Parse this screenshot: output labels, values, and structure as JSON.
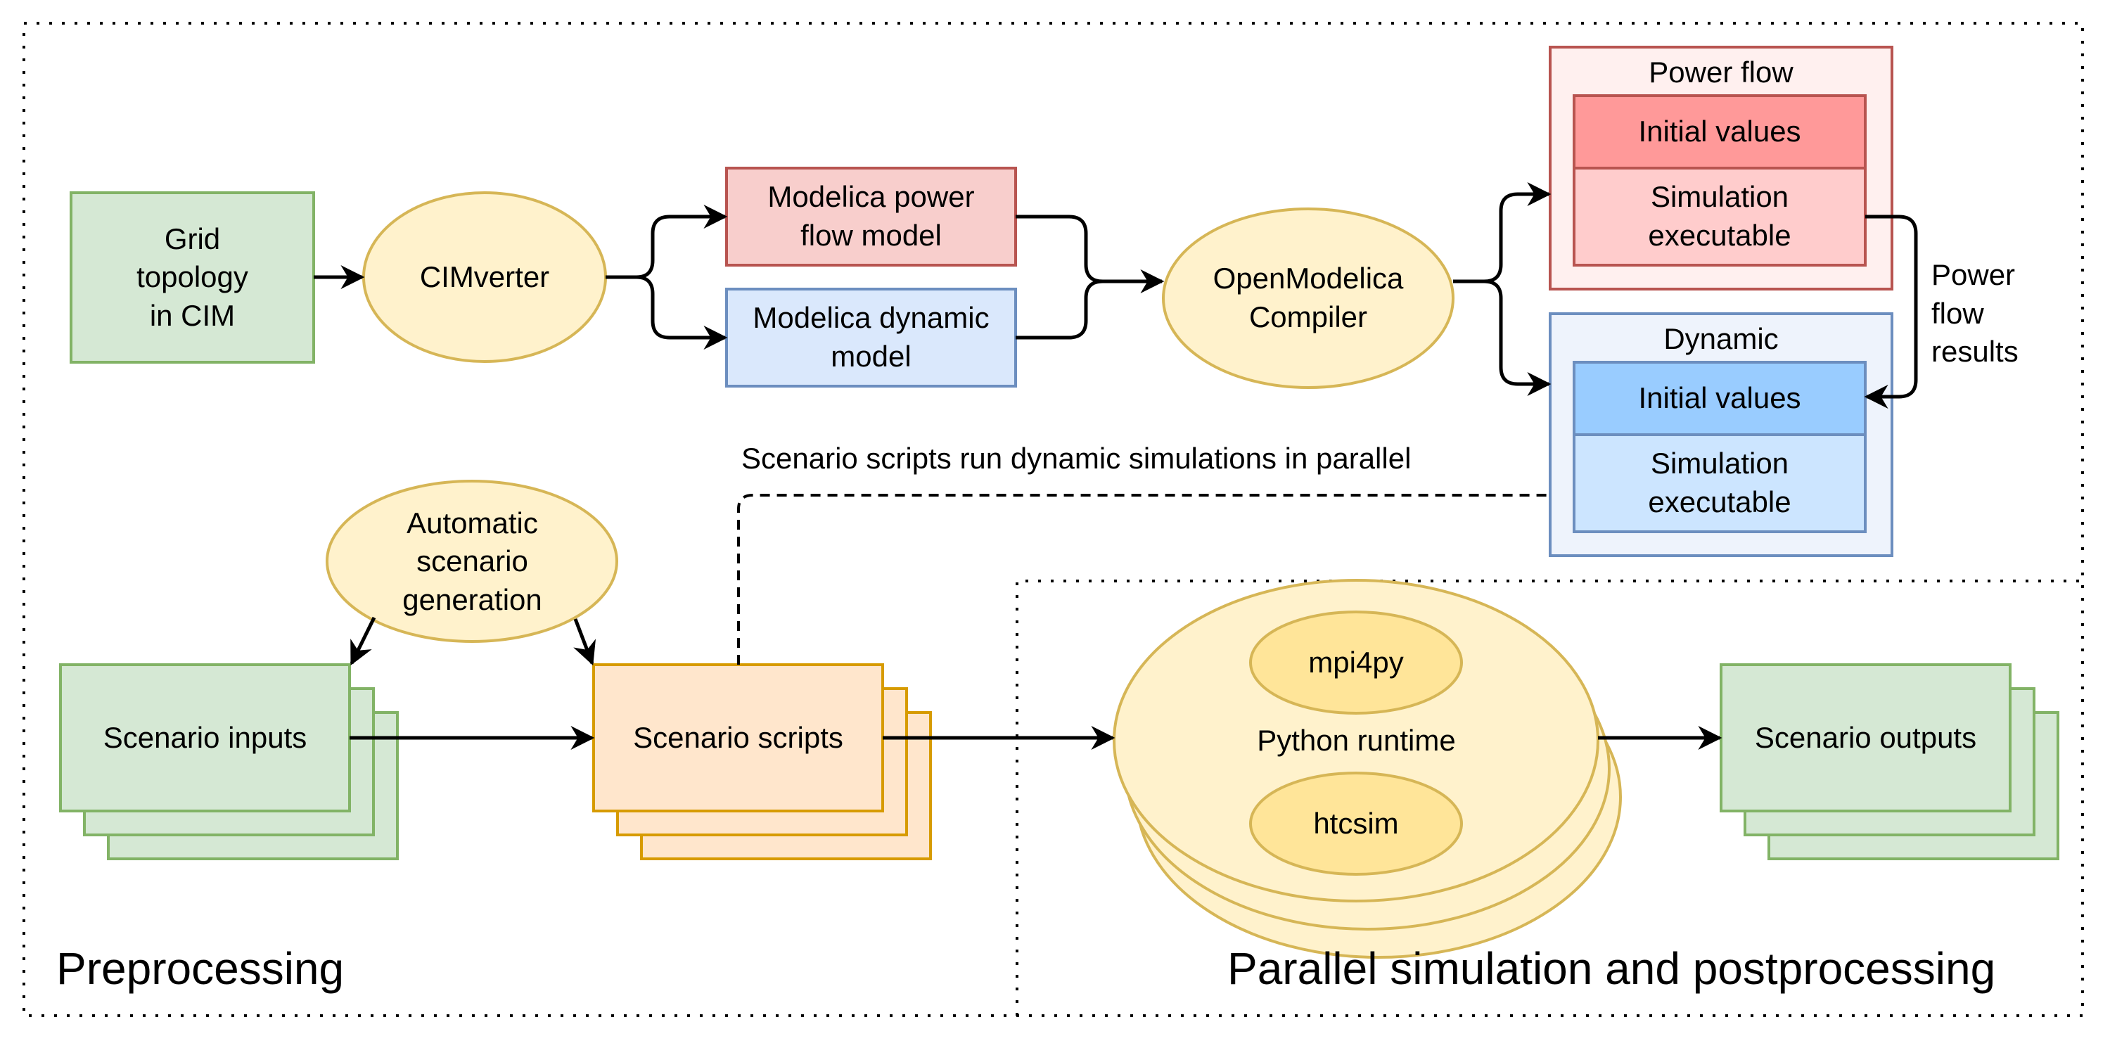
{
  "diagram": {
    "sections": {
      "preprocessing": "Preprocessing",
      "parallel": "Parallel simulation and postprocessing"
    },
    "nodes": {
      "grid_topology": "Grid\ntopology\nin CIM",
      "cimverter": "CIMverter",
      "modelica_power_flow": "Modelica power\nflow model",
      "modelica_dynamic": "Modelica dynamic\nmodel",
      "openmodelica": "OpenModelica\nCompiler",
      "power_flow_group": {
        "title": "Power flow",
        "initial_values": "Initial values",
        "simulation_executable": "Simulation\nexecutable"
      },
      "dynamic_group": {
        "title": "Dynamic",
        "initial_values": "Initial values",
        "simulation_executable": "Simulation\nexecutable"
      },
      "automatic_scenario": "Automatic\nscenario\ngeneration",
      "scenario_inputs": "Scenario inputs",
      "scenario_scripts": "Scenario scripts",
      "python_runtime": "Python  runtime",
      "mpi4py": "mpi4py",
      "htcsim": "htcsim",
      "scenario_outputs": "Scenario outputs"
    },
    "edge_labels": {
      "power_flow_results": "Power\nflow\nresults",
      "parallel_note": "Scenario scripts run dynamic simulations in parallel"
    },
    "colors": {
      "green_fill": "#d5e8d4",
      "green_stroke": "#82b366",
      "yellow_fill": "#fff2cc",
      "yellow_stroke": "#d6b656",
      "yellow_inner": "#ffe599",
      "red_fill": "#f8cecc",
      "red_stroke": "#b85450",
      "red_outer": "#fff0ef",
      "red_header": "#ff9999",
      "red_body": "#ffcccc",
      "blue_fill": "#dae8fc",
      "blue_stroke": "#6c8ebf",
      "blue_outer": "#eef3fc",
      "blue_header": "#99ccff",
      "blue_body": "#cce5ff",
      "orange_fill": "#ffe6cc",
      "orange_stroke": "#d79b00"
    }
  }
}
